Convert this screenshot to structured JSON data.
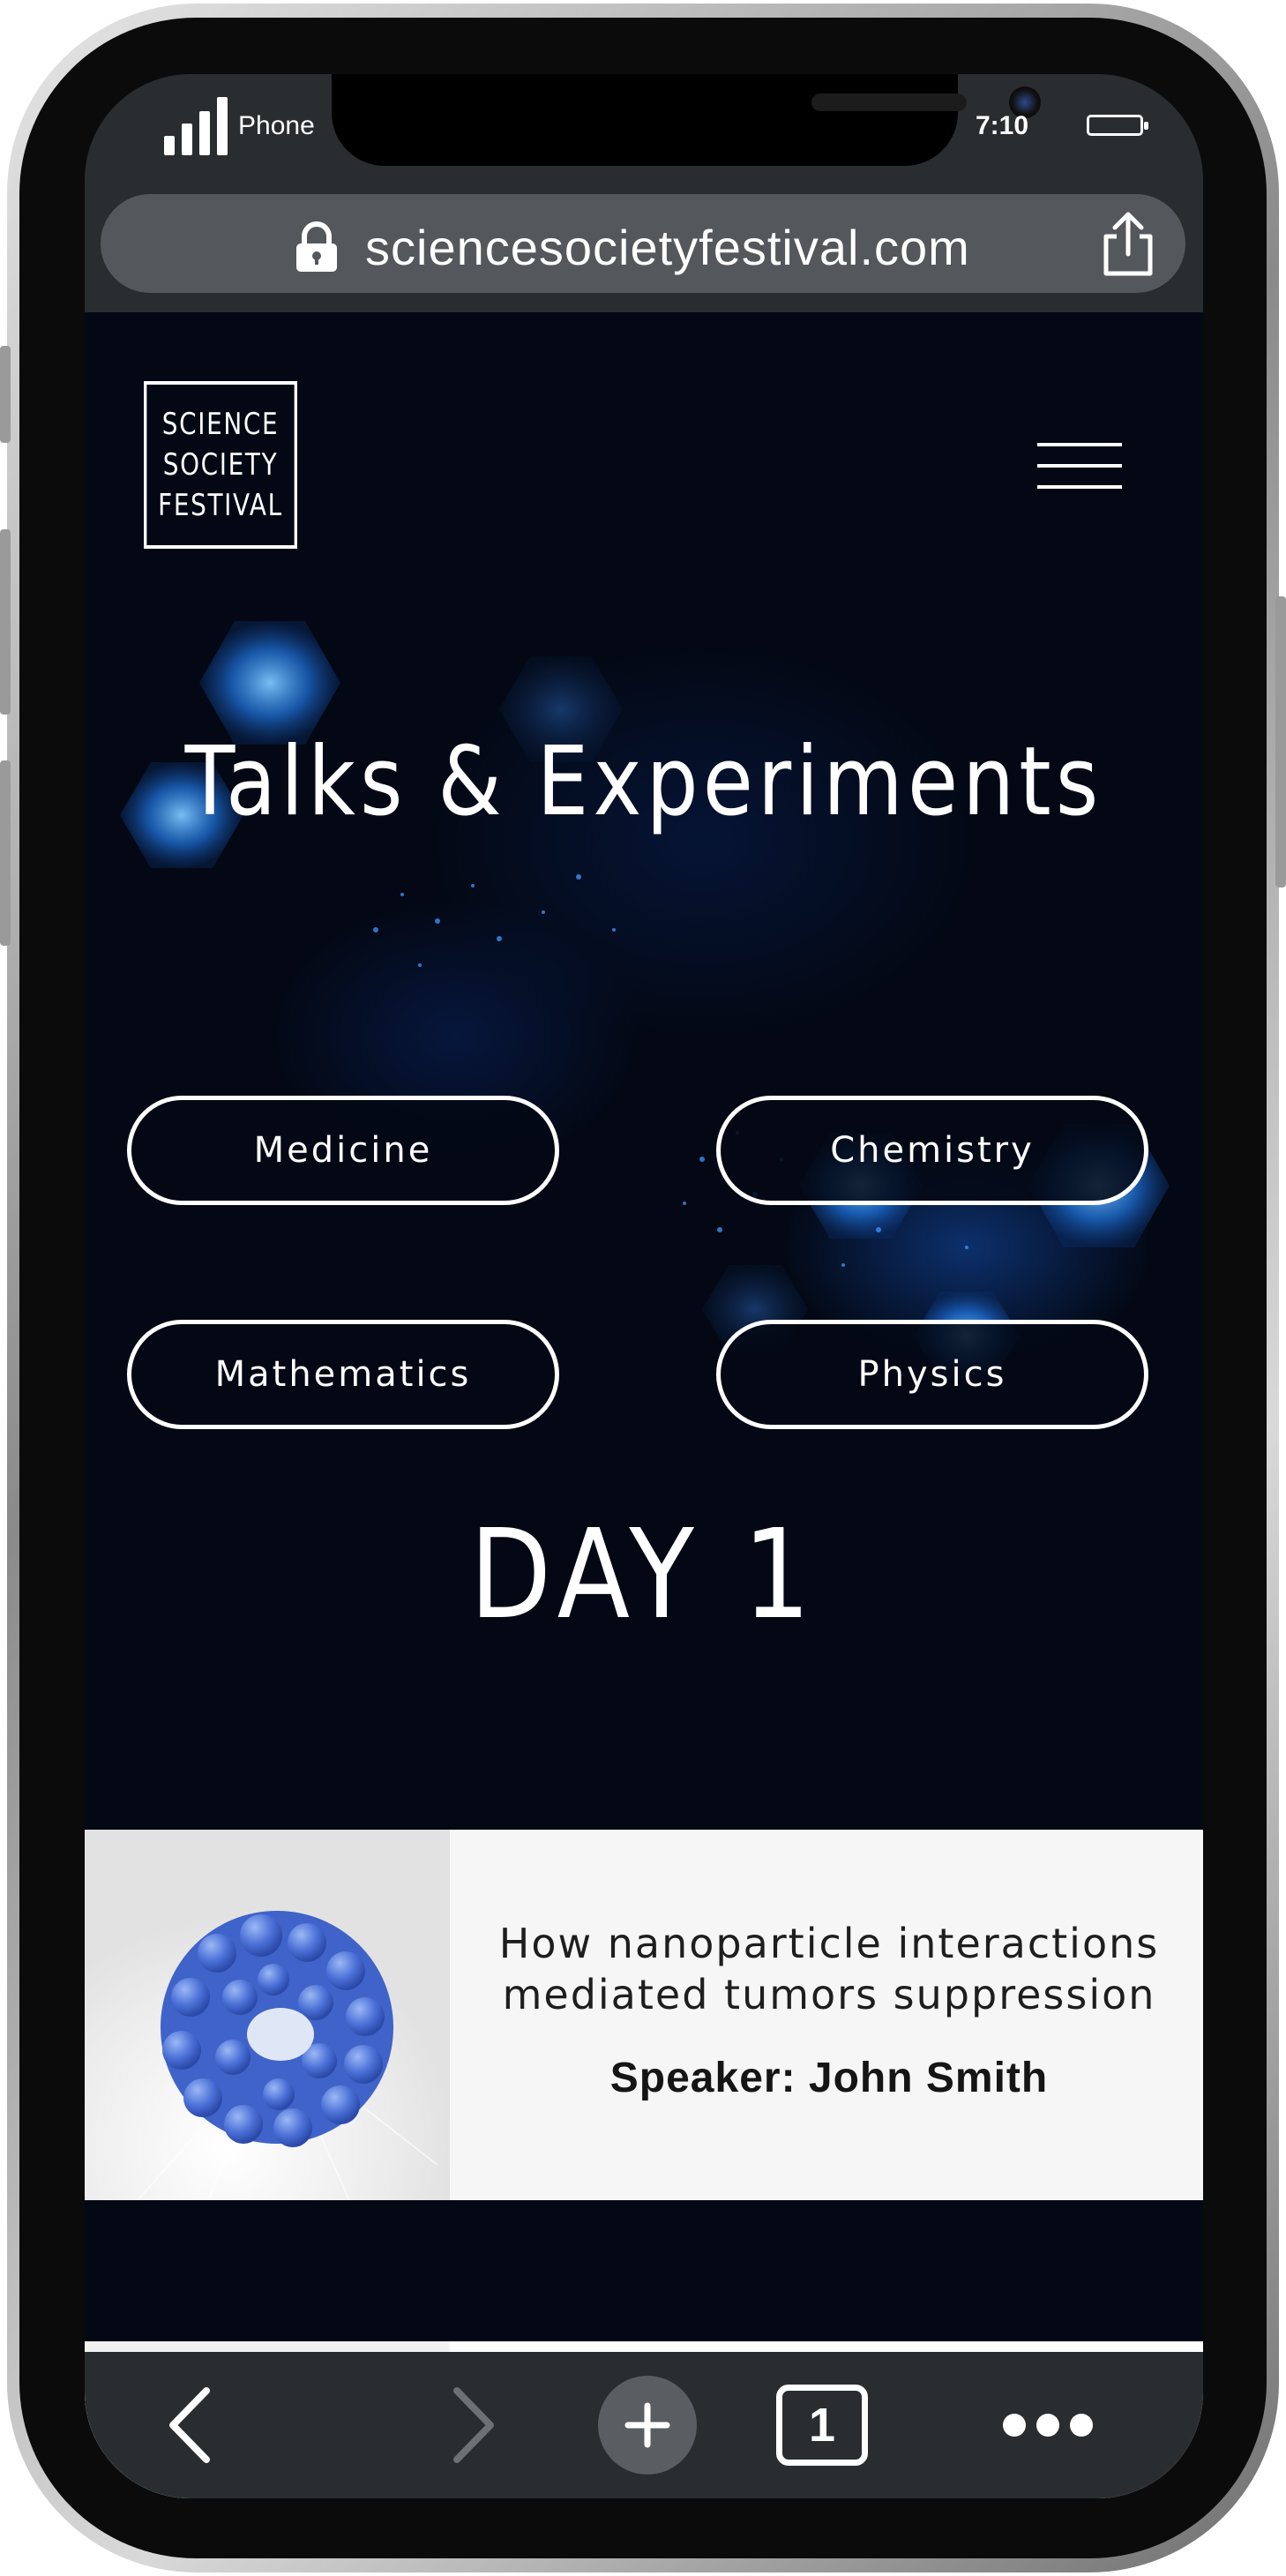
{
  "status_bar": {
    "carrier": "Phone",
    "time": "7:10"
  },
  "browser": {
    "url": "sciencesocietyfestival.com",
    "icons": [
      "lock-icon",
      "share-icon",
      "back-icon",
      "forward-icon",
      "plus-icon",
      "more-icon"
    ],
    "tab_count": "1"
  },
  "site": {
    "logo_lines": [
      "SCIENCE",
      "SOCIETY",
      "FESTIVAL"
    ],
    "menu_icon": "hamburger-menu-icon",
    "hero_title": "Talks & Experiments",
    "categories": [
      "Medicine",
      "Chemistry",
      "Mathematics",
      "Physics"
    ],
    "day_title": "DAY 1",
    "talks": [
      {
        "title_lines": [
          "How nanoparticle interactions",
          "mediated tumors suppression"
        ],
        "speaker": "Speaker: John Smith",
        "image_icon": "nanoparticle-image"
      }
    ]
  },
  "colors": {
    "page_background": "#030814",
    "browser_chrome": "#2a2d30",
    "url_field": "#54585c",
    "accent_blue": "#2f7de0",
    "card_background": "#f6f6f6"
  }
}
